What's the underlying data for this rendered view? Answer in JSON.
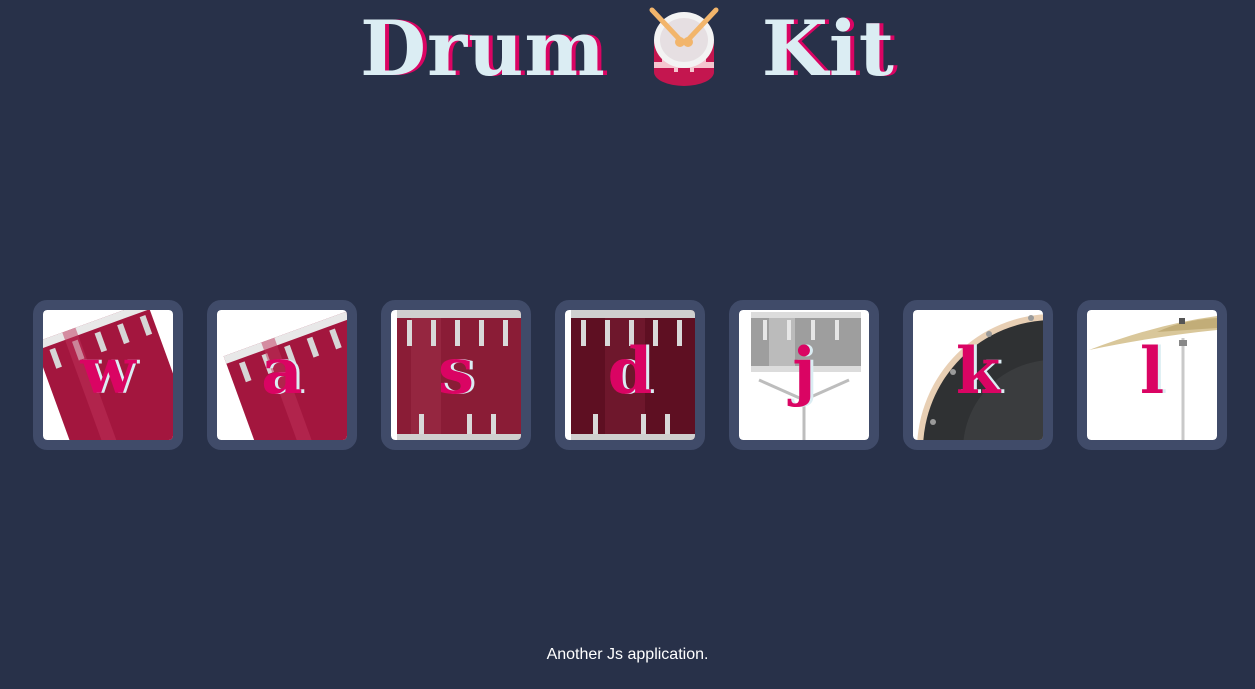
{
  "header": {
    "title_left": "Drum",
    "title_right": "Kit",
    "logo_icon": "drum-icon"
  },
  "drums": [
    {
      "key": "w",
      "style": "tom-tilted-left"
    },
    {
      "key": "a",
      "style": "tom-tilted-right"
    },
    {
      "key": "s",
      "style": "snare-red"
    },
    {
      "key": "d",
      "style": "snare-dark-red"
    },
    {
      "key": "j",
      "style": "snare-silver"
    },
    {
      "key": "k",
      "style": "bass-drum"
    },
    {
      "key": "l",
      "style": "cymbal"
    }
  ],
  "footer": {
    "text": "Another Js application."
  },
  "colors": {
    "background": "#283149",
    "button_border": "#404B69",
    "letter": "#DA0463",
    "title": "#DBEDF3"
  }
}
